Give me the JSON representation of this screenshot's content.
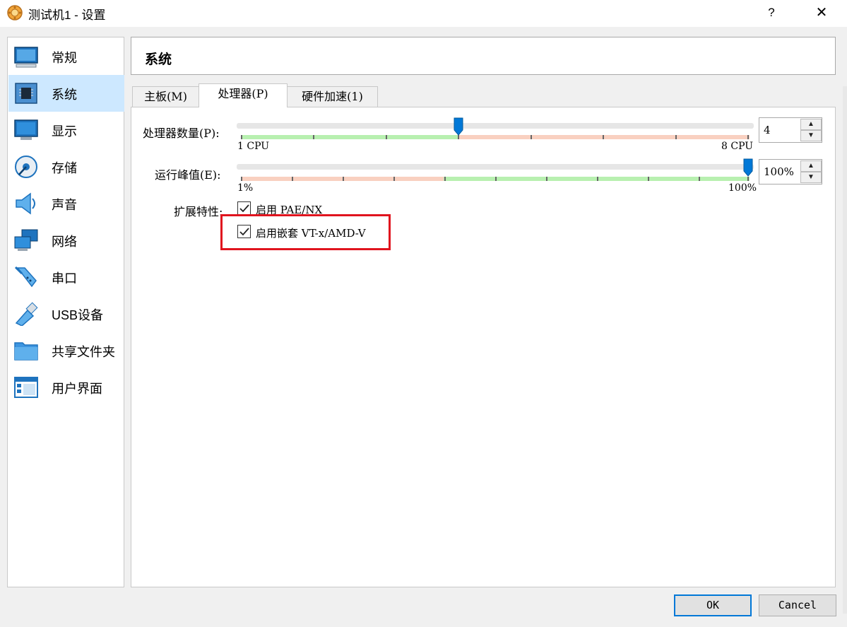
{
  "window": {
    "title": "测试机1 - 设置",
    "help_glyph": "?",
    "close_glyph": "✕"
  },
  "sidebar": {
    "items": [
      {
        "label": "常规",
        "icon": "general-icon"
      },
      {
        "label": "系统",
        "icon": "system-icon",
        "selected": true
      },
      {
        "label": "显示",
        "icon": "display-icon"
      },
      {
        "label": "存储",
        "icon": "storage-icon"
      },
      {
        "label": "声音",
        "icon": "audio-icon"
      },
      {
        "label": "网络",
        "icon": "network-icon"
      },
      {
        "label": "串口",
        "icon": "serial-port-icon"
      },
      {
        "label": "USB设备",
        "icon": "usb-icon"
      },
      {
        "label": "共享文件夹",
        "icon": "shared-folder-icon"
      },
      {
        "label": "用户界面",
        "icon": "user-interface-icon"
      }
    ]
  },
  "section": {
    "title": "系统"
  },
  "tabs": [
    {
      "label": "主板(M)"
    },
    {
      "label": "处理器(P)",
      "active": true
    },
    {
      "label": "硬件加速(1)"
    }
  ],
  "processor": {
    "cpu_count": {
      "label": "处理器数量(P):",
      "min_label": "1 CPU",
      "max_label": "8 CPU",
      "min": 1,
      "max": 8,
      "value": 4,
      "value_text": "4"
    },
    "execution_cap": {
      "label": "运行峰值(E):",
      "min_label": "1%",
      "max_label": "100%",
      "min": 1,
      "max": 100,
      "value": 100,
      "value_text": "100%"
    },
    "extended_features": {
      "label": "扩展特性:",
      "pae_nx": {
        "label": "启用 PAE/NX",
        "checked": true
      },
      "nested_vtx": {
        "label": "启用嵌套 VT-x/AMD-V",
        "checked": true
      }
    }
  },
  "buttons": {
    "ok": "OK",
    "cancel": "Cancel"
  },
  "colors": {
    "green_zone": "#b8f0b0",
    "red_zone": "#f9d0c0",
    "handle": "#0078d7",
    "selected_bg": "#cde8ff",
    "highlight": "#e0141e"
  }
}
